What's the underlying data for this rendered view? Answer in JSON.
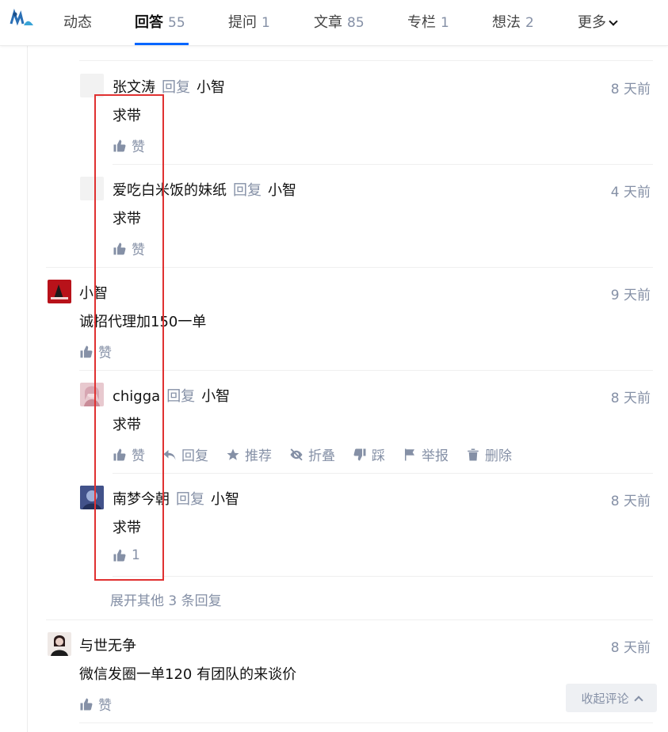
{
  "tabs": [
    {
      "label": "动态",
      "count": ""
    },
    {
      "label": "回答",
      "count": "55"
    },
    {
      "label": "提问",
      "count": "1"
    },
    {
      "label": "文章",
      "count": "85"
    },
    {
      "label": "专栏",
      "count": "1"
    },
    {
      "label": "想法",
      "count": "2"
    },
    {
      "label": "更多",
      "count": ""
    }
  ],
  "comments": [
    {
      "author": "张文涛",
      "reply_word": "回复",
      "reply_to": "小智",
      "time": "8 天前",
      "text": "求带",
      "like": "赞"
    },
    {
      "author": "爱吃白米饭的妹纸",
      "reply_word": "回复",
      "reply_to": "小智",
      "time": "4 天前",
      "text": "求带",
      "like": "赞"
    },
    {
      "author": "小智",
      "time": "9 天前",
      "text": "诚招代理加150一单",
      "like": "赞"
    },
    {
      "author": "chigga",
      "reply_word": "回复",
      "reply_to": "小智",
      "time": "8 天前",
      "text": "求带",
      "actions": {
        "like": "赞",
        "reply": "回复",
        "recommend": "推荐",
        "fold": "折叠",
        "dislike": "踩",
        "report": "举报",
        "delete": "删除"
      }
    },
    {
      "author": "南梦今朝",
      "reply_word": "回复",
      "reply_to": "小智",
      "time": "8 天前",
      "text": "求带",
      "like": "1"
    },
    {
      "author": "与世无争",
      "time": "8 天前",
      "text": "微信发圈一单120 有团队的来谈价",
      "like": "赞"
    }
  ],
  "more_replies": "展开其他 3 条回复",
  "collapse_label": "收起评论",
  "colors": {
    "accent": "#0066ff",
    "muted": "#8590a6",
    "highlight_box": "#e03131"
  }
}
